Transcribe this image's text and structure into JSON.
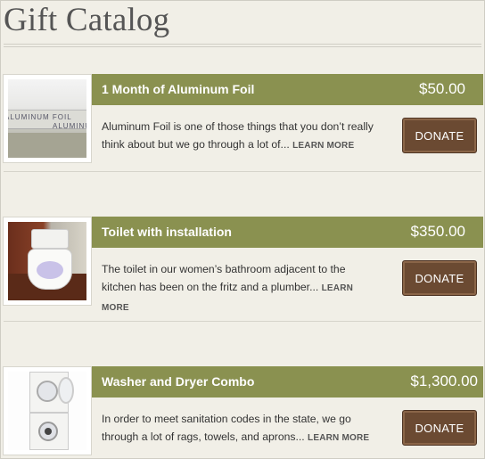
{
  "page": {
    "title": "Gift Catalog"
  },
  "items": [
    {
      "title": "1 Month of Aluminum Foil",
      "price": "$50.00",
      "description": "Aluminum Foil is one of those things that you don’t really think about but we go through a lot of...",
      "learn_more": "LEARN MORE",
      "donate_label": "DONATE",
      "image_text": "ALUMINUM FOIL"
    },
    {
      "title": "Toilet with installation",
      "price": "$350.00",
      "description": "The toilet in our women’s bathroom adjacent to the kitchen has been on the fritz and a plumber...",
      "learn_more": "LEARN MORE",
      "donate_label": "DONATE"
    },
    {
      "title": "Washer and Dryer Combo",
      "price": "$1,300.00",
      "description": "In order to meet sanitation codes in the state, we go through a lot of rags, towels, and aprons...",
      "learn_more": "LEARN MORE",
      "donate_label": "DONATE"
    }
  ],
  "colors": {
    "title_bar": "#8a9150",
    "donate_button": "#6b4a32",
    "background": "#f1efe7"
  }
}
